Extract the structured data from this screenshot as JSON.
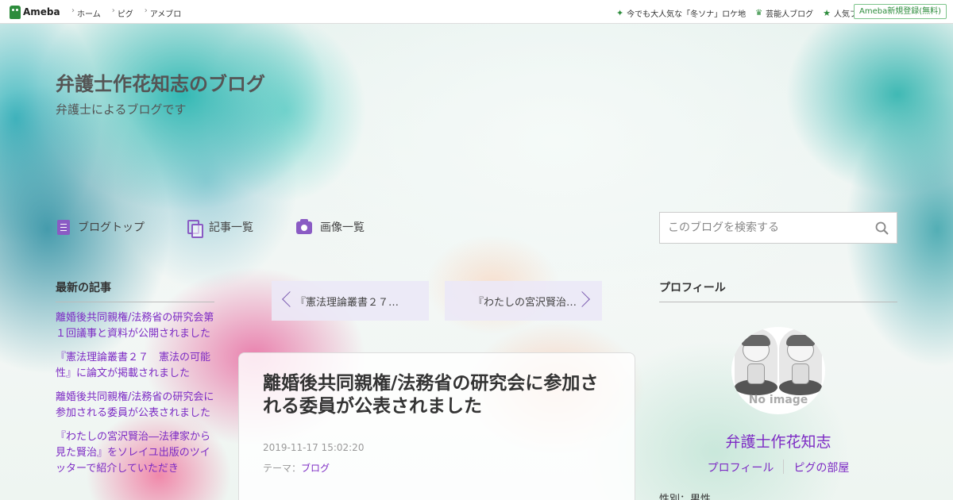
{
  "topbar": {
    "logo_text": "Ameba",
    "nav": [
      "ホーム",
      "ピグ",
      "アメブロ"
    ],
    "right_links": [
      {
        "icon": "sparkle-icon",
        "label": "今でも大人気な「冬ソナ」ロケ地"
      },
      {
        "icon": "crown-icon",
        "label": "芸能人ブログ"
      },
      {
        "icon": "star-icon",
        "label": "人気ブログ"
      }
    ],
    "signup_label": "Ameba新規登録(無料)"
  },
  "blog": {
    "title": "弁護士作花知志のブログ",
    "description": "弁護士によるブログです"
  },
  "nav": {
    "top": "ブログトップ",
    "entries": "記事一覧",
    "images": "画像一覧"
  },
  "search": {
    "placeholder": "このブログを検索する"
  },
  "recent": {
    "heading": "最新の記事",
    "items": [
      "離婚後共同親権/法務省の研究会第１回議事と資料が公開されました",
      "『憲法理論叢書２７　憲法の可能性』に論文が掲載されました",
      "離婚後共同親権/法務省の研究会に参加される委員が公表されました",
      "『わたしの宮沢賢治―法律家から見た賢治』をソレイユ出版のツイッターで紹介していただき"
    ]
  },
  "pager": {
    "prev": "『憲法理論叢書２７…",
    "next": "『わたしの宮沢賢治…"
  },
  "article": {
    "title": "離婚後共同親権/法務省の研究会に参加される委員が公表されました",
    "date": "2019-11-17 15:02:20",
    "theme_label": "テーマ：",
    "theme": "ブログ"
  },
  "profile": {
    "heading": "プロフィール",
    "no_image": "No image",
    "name": "弁護士作花知志",
    "link_profile": "プロフィール",
    "link_pig": "ピグの部屋",
    "gender": "性別：男性"
  },
  "colors": {
    "accent": "#7d2bc4",
    "ameba_green": "#2d8c3c"
  }
}
